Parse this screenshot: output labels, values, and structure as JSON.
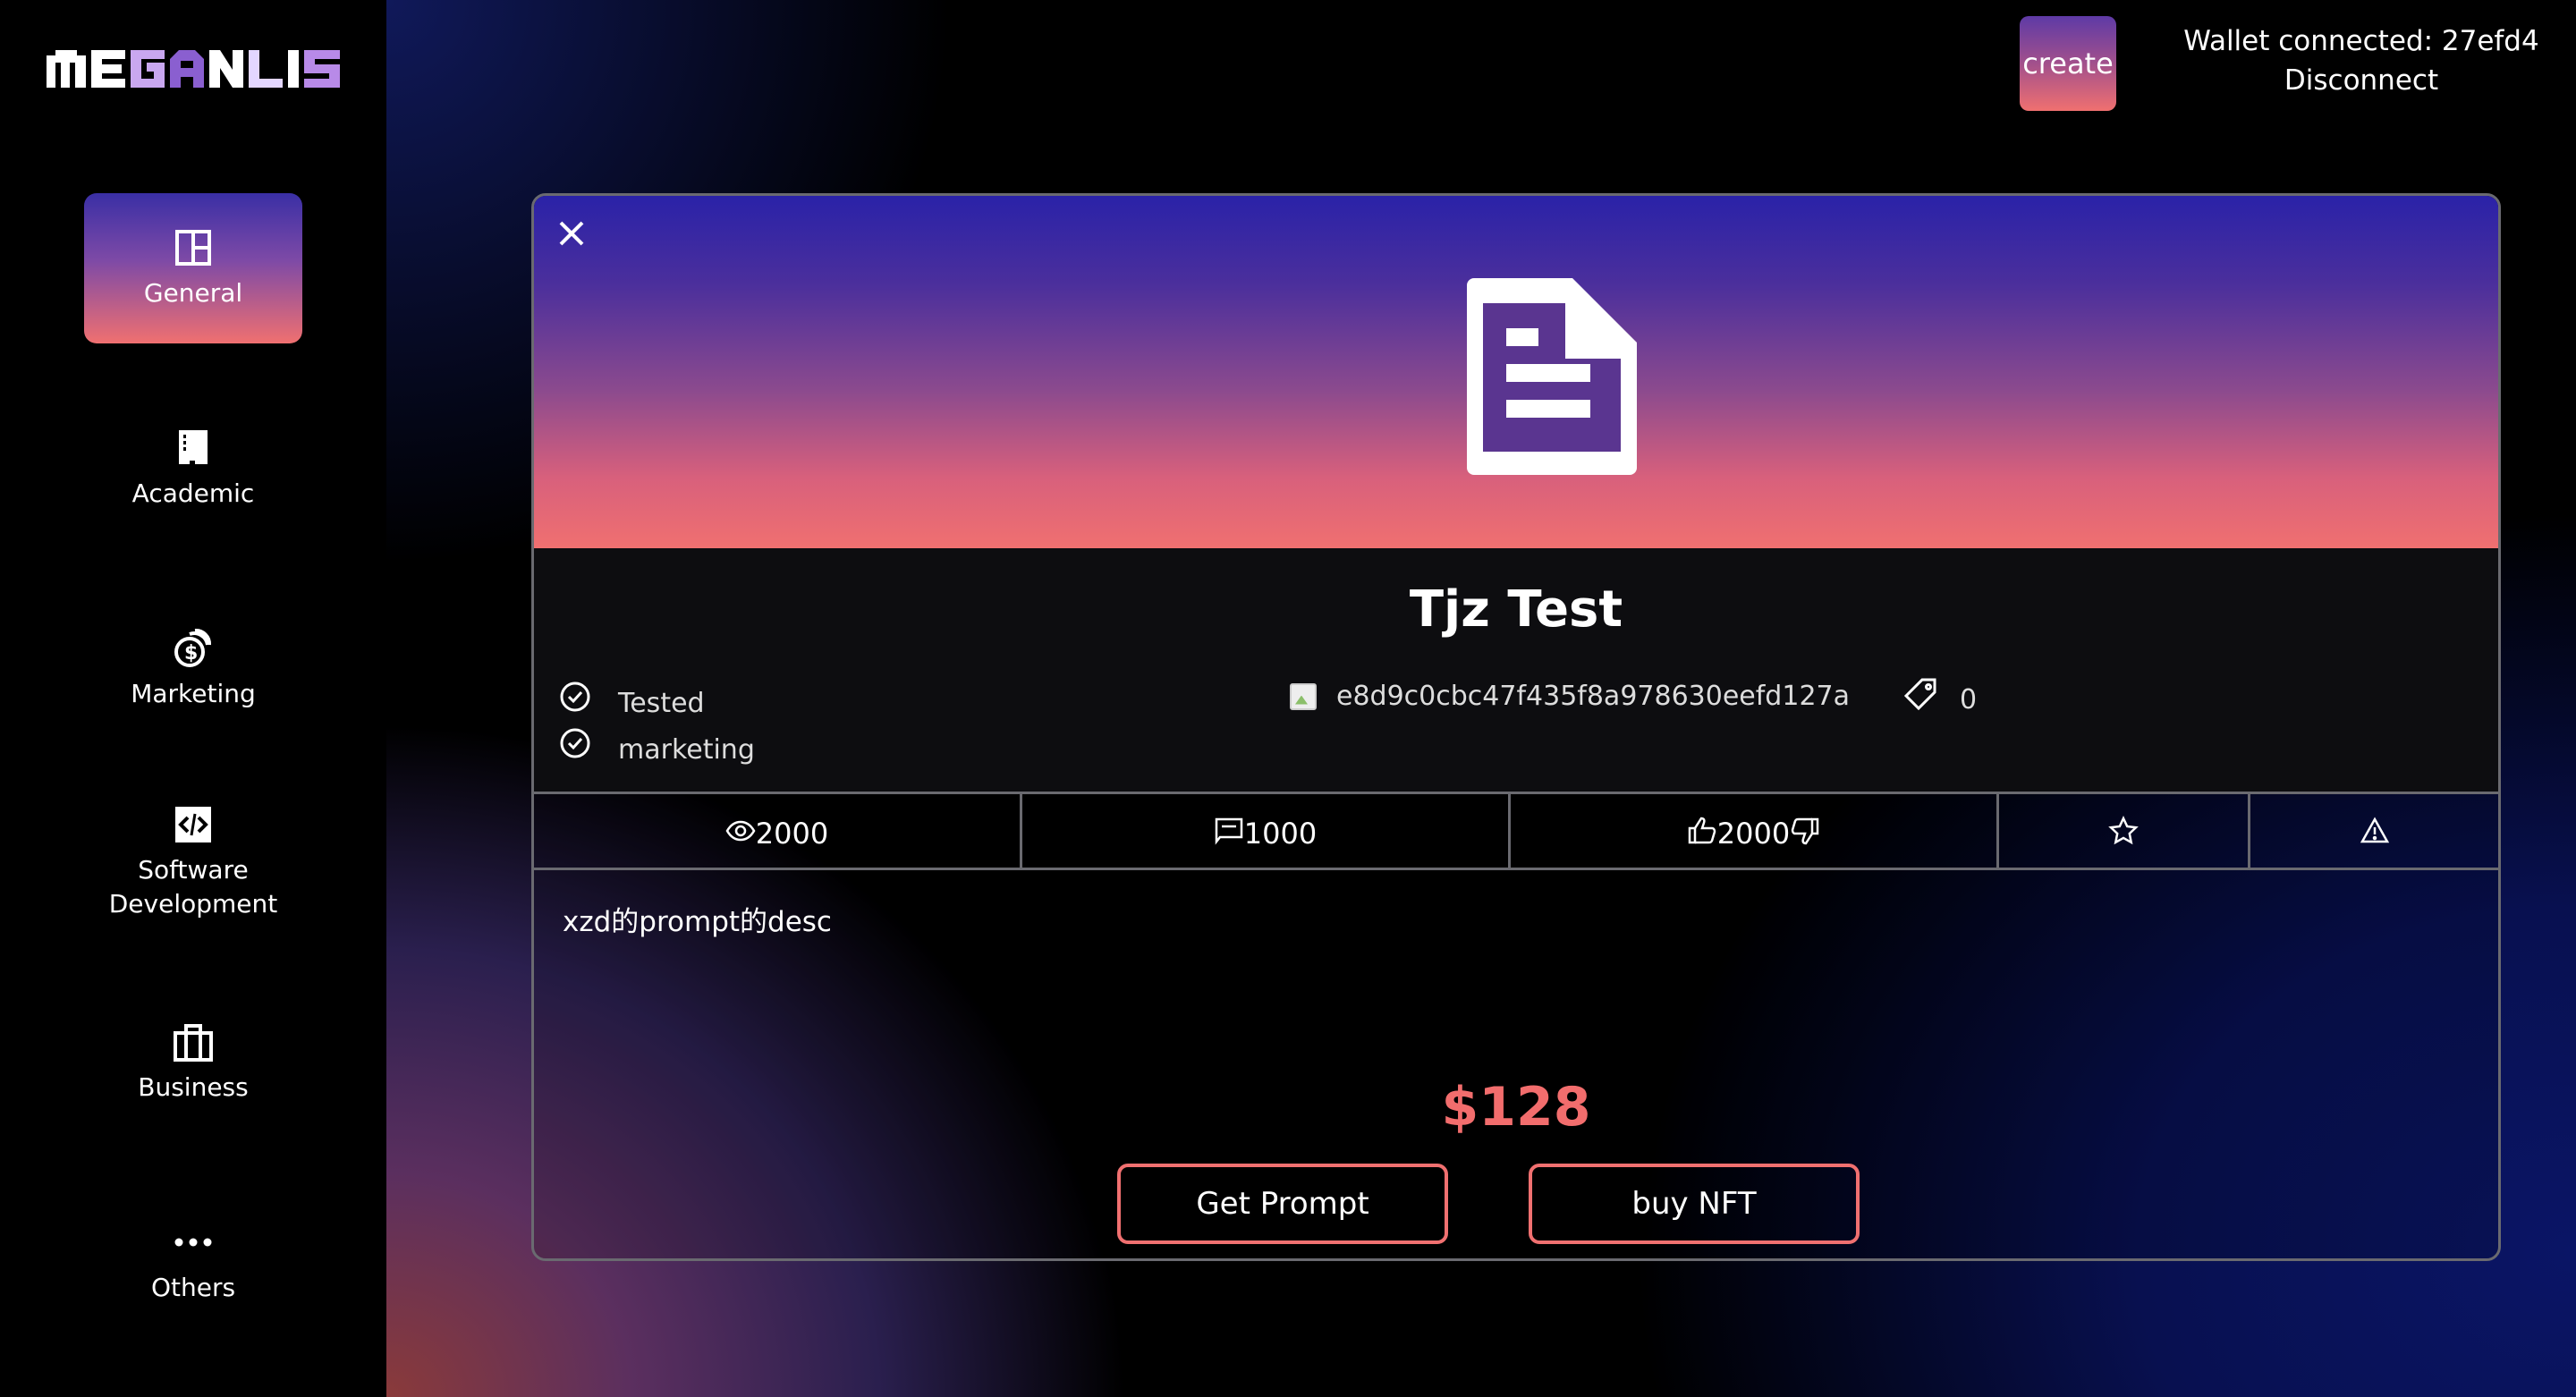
{
  "logo": {
    "text": "MEGANLIS"
  },
  "sidebar": {
    "items": [
      {
        "label": "General",
        "icon": "layout-icon",
        "active": true
      },
      {
        "label": "Academic",
        "icon": "book-icon",
        "active": false
      },
      {
        "label": "Marketing",
        "icon": "coins-icon",
        "active": false
      },
      {
        "label": "Software Development",
        "icon": "code-icon",
        "active": false
      },
      {
        "label": "Business",
        "icon": "briefcase-icon",
        "active": false
      },
      {
        "label": "Others",
        "icon": "more-icon",
        "active": false
      }
    ]
  },
  "header": {
    "create_label": "create",
    "wallet_text": "Wallet connected: 27efd4",
    "disconnect_label": "Disconnect"
  },
  "modal": {
    "title": "Tjz Test",
    "tags": [
      "Tested",
      "marketing"
    ],
    "hash": "e8d9c0cbc47f435f8a978630eefd127a",
    "price_tag_count": "0",
    "stats": {
      "views": "2000",
      "comments": "1000",
      "likes": "2000"
    },
    "description": "xzd的prompt的desc",
    "price": "$128",
    "get_prompt_label": "Get Prompt",
    "buy_nft_label": "buy NFT"
  },
  "colors": {
    "accent": "#f07070",
    "gradient_top": "#2a22a8",
    "border": "#6a6a70"
  }
}
